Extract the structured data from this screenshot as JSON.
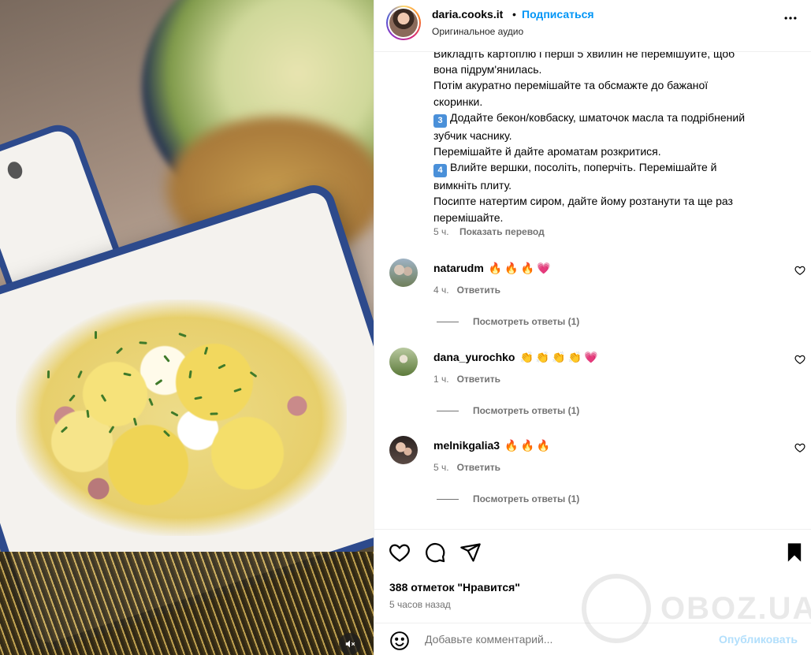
{
  "header": {
    "username": "daria.cooks.it",
    "dot": "•",
    "follow_label": "Подписаться",
    "audio": "Оригинальное аудио"
  },
  "caption": {
    "lines": [
      "Викладіть картоплю і перші 5 хвилин не перемішуйте, щоб",
      "вона підрум'янилась.",
      "Потім акуратно перемішайте та обсмажте до бажаної",
      "скоринки.",
      "Додайте бекон/ковбаску, шматочок масла та подрібнений",
      "зубчик часнику.",
      "Перемішайте й дайте ароматам розкритися.",
      "Влийте вершки, посоліть, поперчіть. Перемішайте й",
      "вимкніть плиту.",
      "Посипте натертим сиром, дайте йому розтанути та ще раз",
      "перемішайте."
    ],
    "step3": "3",
    "step4": "4",
    "time": "5 ч.",
    "translate_label": "Показать перевод"
  },
  "comments": [
    {
      "username": "natarudm",
      "emoji": "🔥🔥🔥💗",
      "time": "4 ч.",
      "reply": "Ответить",
      "view_replies": "Посмотреть ответы (1)"
    },
    {
      "username": "dana_yurochko",
      "emoji": "👏👏👏👏💗",
      "time": "1 ч.",
      "reply": "Ответить",
      "view_replies": "Посмотреть ответы (1)"
    },
    {
      "username": "melnikgalia3",
      "emoji": "🔥🔥🔥",
      "time": "5 ч.",
      "reply": "Ответить",
      "view_replies": "Посмотреть ответы (1)"
    }
  ],
  "footer": {
    "likes": "388 отметок \"Нравится\"",
    "ago": "5 часов назад",
    "comment_placeholder": "Добавьте комментарий...",
    "publish_label": "Опубликовать"
  },
  "watermark": {
    "text": "OBOZ.UA"
  },
  "icons": {
    "heart": "heart-icon",
    "comment": "comment-icon",
    "share": "share-icon",
    "bookmark": "bookmark-icon",
    "emoji": "emoji-icon",
    "more": "more-icon",
    "mute": "mute-icon"
  },
  "colors": {
    "accent": "#0095f6",
    "publish_disabled": "#b2dffc",
    "meta": "#737373"
  }
}
